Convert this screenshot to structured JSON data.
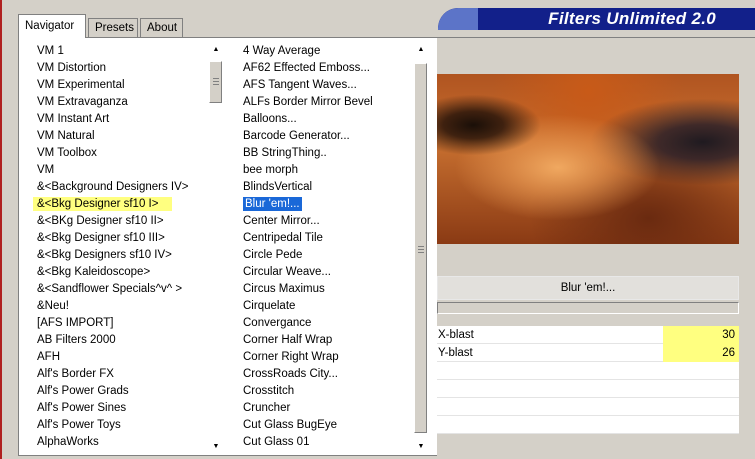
{
  "app": {
    "title": "Filters Unlimited 2.0",
    "colors": {
      "banner": "#12208a",
      "highlight": "#ffff80",
      "selection": "#1a68d8"
    }
  },
  "tabs": [
    {
      "label": "Navigator",
      "active": true
    },
    {
      "label": "Presets",
      "active": false
    },
    {
      "label": "About",
      "active": false
    }
  ],
  "categories": {
    "items": [
      "VM 1",
      "VM Distortion",
      "VM Experimental",
      "VM Extravaganza",
      "VM Instant Art",
      "VM Natural",
      "VM Toolbox",
      "VM",
      "&<Background Designers IV>",
      "&<Bkg Designer sf10 I>",
      "&<BKg Designer sf10 II>",
      "&<Bkg Designer sf10 III>",
      "&<Bkg Designers sf10 IV>",
      "&<Bkg Kaleidoscope>",
      "&<Sandflower Specials^v^ >",
      "&Neu!",
      "[AFS IMPORT]",
      "AB Filters 2000",
      "AFH",
      "Alf's Border FX",
      "Alf's Power Grads",
      "Alf's Power Sines",
      "Alf's Power Toys",
      "AlphaWorks"
    ],
    "highlighted_index": 9
  },
  "filters": {
    "items": [
      "4 Way Average",
      "AF62 Effected Emboss...",
      "AFS Tangent Waves...",
      "ALFs Border Mirror Bevel",
      "Balloons...",
      "Barcode Generator...",
      "BB StringThing..",
      "bee morph",
      "BlindsVertical",
      "Blur 'em!...",
      "Center Mirror...",
      "Centripedal Tile",
      "Circle Pede",
      "Circular Weave...",
      "Circus Maximus",
      "Cirquelate",
      "Convergance",
      "Corner Half Wrap",
      "Corner Right Wrap",
      "CrossRoads City...",
      "Crosstitch",
      "Cruncher",
      "Cut Glass  BugEye",
      "Cut Glass 01"
    ],
    "selected_index": 9
  },
  "right_panel": {
    "filter_button_label": "Blur 'em!...",
    "progress": 0,
    "params": [
      {
        "name": "X-blast",
        "value": "30"
      },
      {
        "name": "Y-blast",
        "value": "26"
      }
    ],
    "empty_rows": 4
  }
}
